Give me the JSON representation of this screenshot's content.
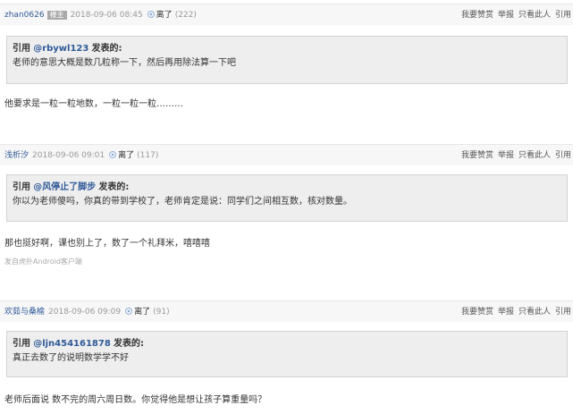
{
  "posts": [
    {
      "author": "zhan0626",
      "badge": "楼主",
      "time": "2018-09-06 08:45",
      "status": "离了",
      "status_count": "(222)",
      "actions": [
        "我要赞赏",
        "举报",
        "只看此人",
        "引用"
      ],
      "quote": {
        "label": "引用",
        "user": "@rbywl123",
        "said": "发表的:",
        "text": "老师的意思大概是数几粒称一下，然后再用除法算一下吧"
      },
      "content": "他要求是一粒一粒地数，一粒一粒一粒………",
      "source": ""
    },
    {
      "author": "浅析汐",
      "badge": "",
      "time": "2018-09-06 09:01",
      "status": "离了",
      "status_count": "(117)",
      "actions": [
        "我要赞赏",
        "举报",
        "只看此人",
        "引用"
      ],
      "quote": {
        "label": "引用",
        "user": "@风停止了脚步",
        "said": "发表的:",
        "text": "你以为老师傻吗，你真的带到学校了，老师肯定是说：同学们之间相互数，核对数量。"
      },
      "content": "那也挺好啊，课也别上了，数了一个礼拜米，嘻嘻嘻",
      "source": "发自虎扑Android客户端"
    },
    {
      "author": "欢茹与桑榆",
      "badge": "",
      "time": "2018-09-06 09:09",
      "status": "离了",
      "status_count": "(91)",
      "actions": [
        "我要赞赏",
        "举报",
        "只看此人",
        "引用"
      ],
      "quote": {
        "label": "引用",
        "user": "@ljn454161878",
        "said": "发表的:",
        "text": "真正去数了的说明数学学不好"
      },
      "content": "老师后面说 数不完的周六周日数。你觉得他是想让孩子算重量吗？",
      "source": ""
    }
  ]
}
